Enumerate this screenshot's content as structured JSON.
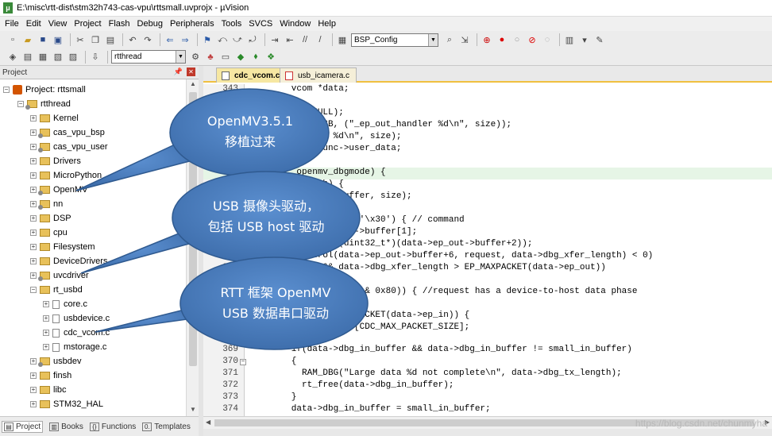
{
  "window": {
    "title": "E:\\misc\\rtt-dist\\stm32h743-cas-vpu\\rttsmall.uvprojx - µVision"
  },
  "menu": [
    "File",
    "Edit",
    "View",
    "Project",
    "Flash",
    "Debug",
    "Peripherals",
    "Tools",
    "SVCS",
    "Window",
    "Help"
  ],
  "toolbar": {
    "config_combo": "BSP_Config",
    "target_combo": "rtthread"
  },
  "project_panel": {
    "title": "Project"
  },
  "tree": [
    {
      "label": "Project: rttsmall"
    },
    {
      "label": "rtthread"
    },
    {
      "label": "Kernel"
    },
    {
      "label": "cas_vpu_bsp"
    },
    {
      "label": "cas_vpu_user"
    },
    {
      "label": "Drivers"
    },
    {
      "label": "MicroPython"
    },
    {
      "label": "OpenMV"
    },
    {
      "label": "nn"
    },
    {
      "label": "DSP"
    },
    {
      "label": "cpu"
    },
    {
      "label": "Filesystem"
    },
    {
      "label": "DeviceDrivers"
    },
    {
      "label": "uvcdriver"
    },
    {
      "label": "rt_usbd"
    },
    {
      "label": "core.c"
    },
    {
      "label": "usbdevice.c"
    },
    {
      "label": "cdc_vcom.c"
    },
    {
      "label": "mstorage.c"
    },
    {
      "label": "usbdev"
    },
    {
      "label": "finsh"
    },
    {
      "label": "libc"
    },
    {
      "label": "STM32_HAL"
    }
  ],
  "bottom_tabs": [
    {
      "label": "Project",
      "icon": "project-icon"
    },
    {
      "label": "Books",
      "icon": "books-icon"
    },
    {
      "label": "Functions",
      "icon": "functions-icon"
    },
    {
      "label": "Templates",
      "icon": "templates-icon"
    }
  ],
  "editor_tabs": [
    {
      "label": "cdc_vcom.c",
      "active": true
    },
    {
      "label": "usb_icamera.c",
      "active": false
    }
  ],
  "code": [
    {
      "ln": "343",
      "text": "        vcom *data;"
    },
    {
      "ln": "344",
      "text": ""
    },
    {
      "ln": "345",
      "text": "         RT_NULL);"
    },
    {
      "ln": "346",
      "text": "         BUG_USB, (\"_ep_out_handler %d\\n\", size));"
    },
    {
      "ln": "347",
      "text": "         andler %d\\n\", size);"
    },
    {
      "ln": "348",
      "text": "         om*)func->user_data;"
    },
    {
      "ln": "349",
      "text": ""
    },
    {
      "ln": "350",
      "text": "         openmv_dbgmode) {"
    },
    {
      "ln": "351",
      "text": "         length) {"
    },
    {
      "ln": "352",
      "text": "         ep_out->buffer, size);"
    },
    {
      "ln": "353",
      "text": "          size;"
    },
    {
      "ln": "354",
      "text": "         uffer[0] == '\\x30') { // command"
    },
    {
      "ln": "355",
      "text": "         ata->ep_out->buffer[1];"
    },
    {
      "ln": "356",
      "text": "         gth = *((uint32_t*)(data->ep_out->buffer+2));"
    },
    {
      "ln": "357",
      "text": "         control(data->ep_out->buffer+6, request, data->dbg_xfer_length) < 0)"
    },
    {
      "ln": "358",
      "text": "         0x84 && data->dbg_xfer_length > EP_MAXPACKET(data->ep_out))"
    },
    {
      "ln": "359",
      "text": "         gth = 4;"
    },
    {
      "ln": "360",
      "text": "          && (request & 0x80)) { //request has a device-to-host data phase"
    },
    {
      "ln": "361",
      "text": "         d data\\n\");"
    },
    {
      "ln": "362",
      "text": "         h <= EP_MAXPACKET(data->ep_in)) {"
    },
    {
      "ln": "363",
      "text": "         l_in_buffer[CDC_MAX_PACKET_SIZE];"
    },
    {
      "ln": "364",
      "text": ""
    },
    {
      "ln": "369",
      "text": "        if(data->dbg_in_buffer && data->dbg_in_buffer != small_in_buffer)"
    },
    {
      "ln": "370",
      "text": "        {"
    },
    {
      "ln": "371",
      "text": "          RAM_DBG(\"Large data %d not complete\\n\", data->dbg_tx_length);"
    },
    {
      "ln": "372",
      "text": "          rt_free(data->dbg_in_buffer);"
    },
    {
      "ln": "373",
      "text": "        }"
    },
    {
      "ln": "374",
      "text": "        data->dbg_in_buffer = small_in_buffer;"
    }
  ],
  "callouts": [
    {
      "line1": "OpenMV3.5.1",
      "line2": "移植过来",
      "color": "#4f81bd"
    },
    {
      "line1": "USB 摄像头驱动，",
      "line2": "包括 USB host 驱动",
      "color": "#4f81bd"
    },
    {
      "line1": "RTT 框架 OpenMV",
      "line2": "USB 数据串口驱动",
      "color": "#4f81bd"
    }
  ],
  "watermark": "https://blog.csdn.net/chunmyha"
}
